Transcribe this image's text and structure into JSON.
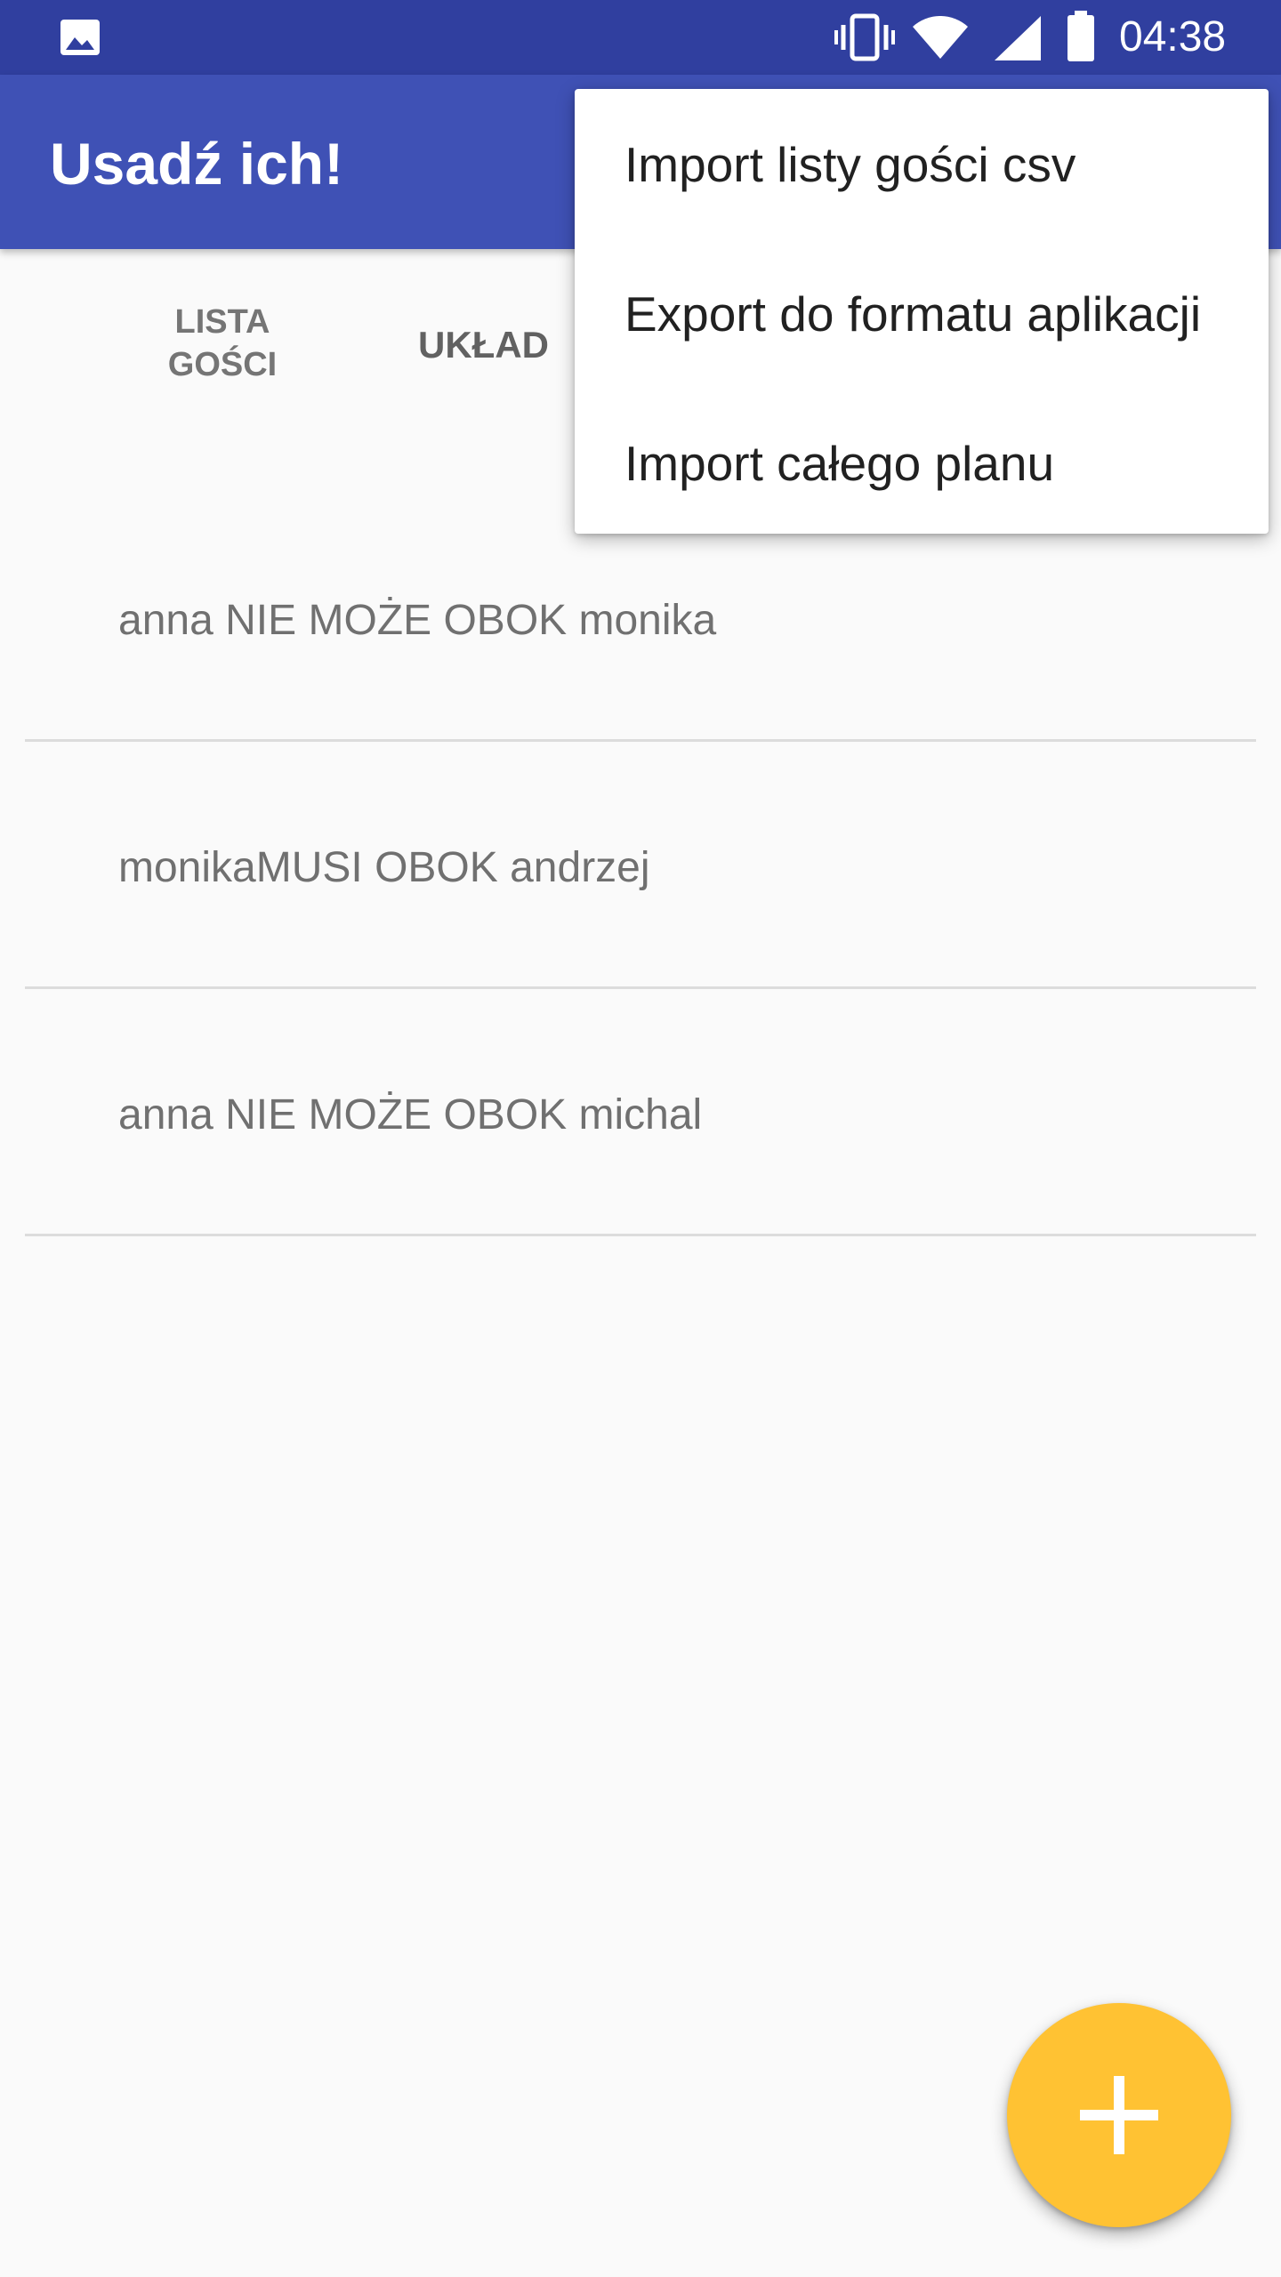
{
  "status_bar": {
    "time": "04:38",
    "icons": [
      "gallery-icon",
      "vibrate-icon",
      "wifi-icon",
      "signal-icon",
      "battery-icon"
    ]
  },
  "app_bar": {
    "title": "Usadź ich!"
  },
  "tabs": [
    {
      "label_line1": "LISTA",
      "label_line2": "GOŚCI"
    },
    {
      "label": "UKŁAD"
    }
  ],
  "rules": [
    {
      "text": "anna NIE MOŻE OBOK monika"
    },
    {
      "text": "monikaMUSI OBOK andrzej"
    },
    {
      "text": "anna NIE MOŻE OBOK michal"
    }
  ],
  "overflow_menu": {
    "items": [
      {
        "label": "Import listy gości csv"
      },
      {
        "label": "Export do formatu aplikacji"
      },
      {
        "label": "Import całego planu"
      }
    ]
  },
  "fab": {
    "icon": "plus-icon",
    "color": "#ffc233"
  },
  "colors": {
    "primary": "#3f51b5",
    "primary_dark": "#303f9f",
    "accent": "#ffc233"
  }
}
